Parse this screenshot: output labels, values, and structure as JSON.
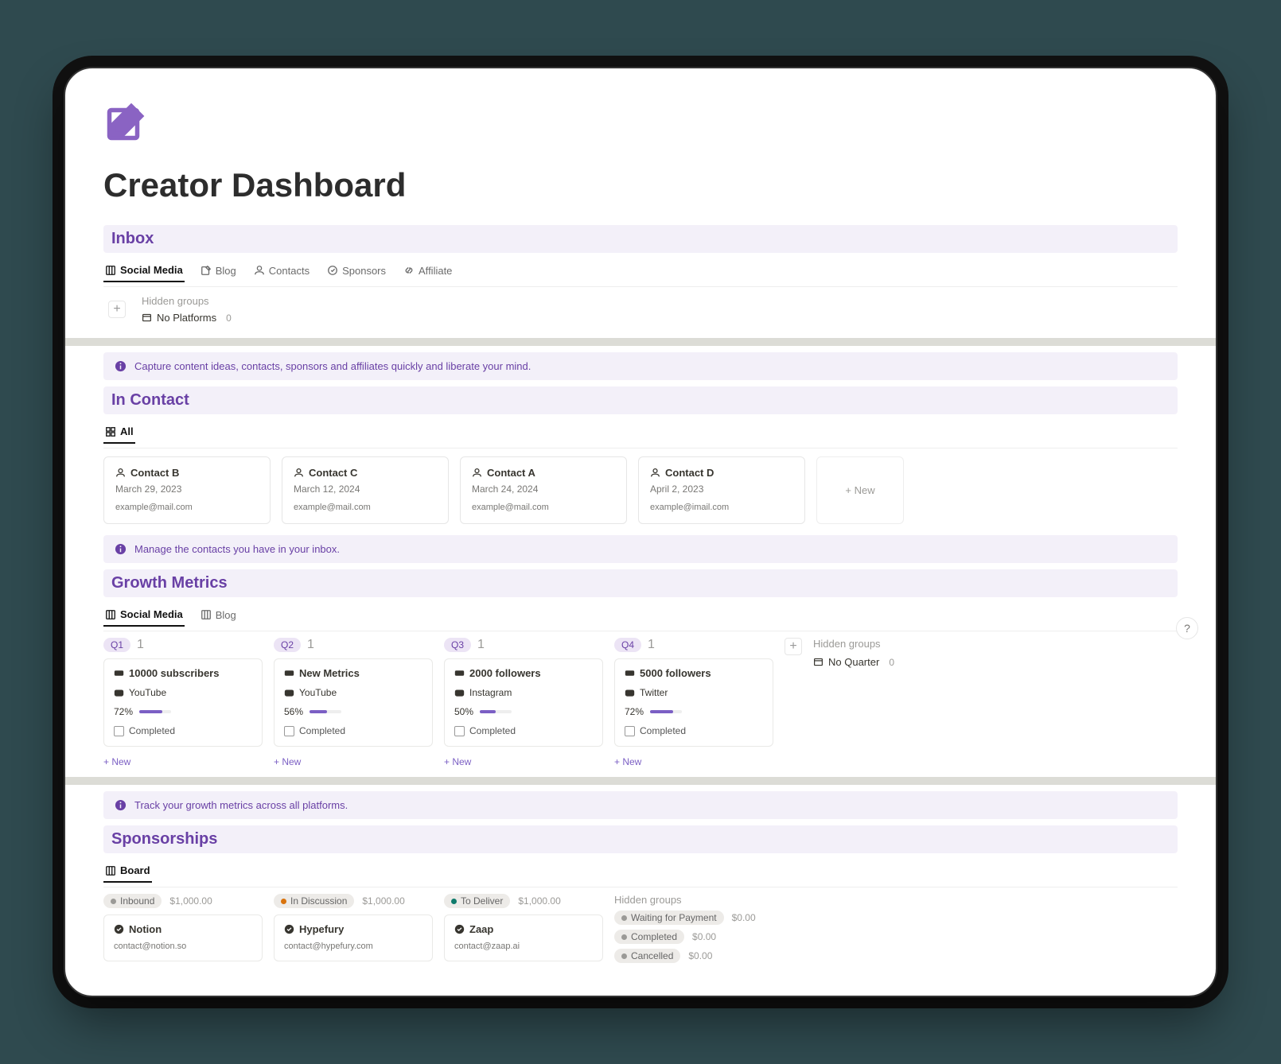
{
  "page": {
    "title": "Creator Dashboard"
  },
  "inbox": {
    "header": "Inbox",
    "tabs": [
      {
        "label": "Social Media"
      },
      {
        "label": "Blog"
      },
      {
        "label": "Contacts"
      },
      {
        "label": "Sponsors"
      },
      {
        "label": "Affiliate"
      }
    ],
    "hidden_groups_label": "Hidden groups",
    "no_platforms_label": "No Platforms",
    "no_platforms_count": "0",
    "info": "Capture content ideas, contacts, sponsors and affiliates quickly and liberate your mind."
  },
  "contacts": {
    "header": "In Contact",
    "tab_label": "All",
    "items": [
      {
        "name": "Contact B",
        "date": "March 29, 2023",
        "email": "example@mail.com"
      },
      {
        "name": "Contact C",
        "date": "March 12, 2024",
        "email": "example@mail.com"
      },
      {
        "name": "Contact A",
        "date": "March 24, 2024",
        "email": "example@mail.com"
      },
      {
        "name": "Contact D",
        "date": "April 2, 2023",
        "email": "example@imail.com"
      }
    ],
    "new_label": "+  New",
    "info": "Manage the contacts you have in your inbox."
  },
  "growth": {
    "header": "Growth Metrics",
    "tabs": [
      {
        "label": "Social Media"
      },
      {
        "label": "Blog"
      }
    ],
    "columns": [
      {
        "quarter": "Q1",
        "count": "1",
        "title": "10000 subscribers",
        "platform": "YouTube",
        "progress_label": "72%",
        "progress_pct": 72,
        "completed_label": "Completed",
        "new_label": "+  New"
      },
      {
        "quarter": "Q2",
        "count": "1",
        "title": "New Metrics",
        "platform": "YouTube",
        "progress_label": "56%",
        "progress_pct": 56,
        "completed_label": "Completed",
        "new_label": "+  New"
      },
      {
        "quarter": "Q3",
        "count": "1",
        "title": "2000 followers",
        "platform": "Instagram",
        "progress_label": "50%",
        "progress_pct": 50,
        "completed_label": "Completed",
        "new_label": "+  New"
      },
      {
        "quarter": "Q4",
        "count": "1",
        "title": "5000 followers",
        "platform": "Twitter",
        "progress_label": "72%",
        "progress_pct": 72,
        "completed_label": "Completed",
        "new_label": "+  New"
      }
    ],
    "hidden_groups_label": "Hidden groups",
    "no_quarter_label": "No Quarter",
    "no_quarter_count": "0",
    "info": "Track your growth metrics across all platforms."
  },
  "sponsorships": {
    "header": "Sponsorships",
    "tab_label": "Board",
    "columns": [
      {
        "status": "Inbound",
        "dot": "#9b9a97",
        "amount": "$1,000.00",
        "name": "Notion",
        "email": "contact@notion.so"
      },
      {
        "status": "In Discussion",
        "dot": "#d9730d",
        "amount": "$1,000.00",
        "name": "Hypefury",
        "email": "contact@hypefury.com"
      },
      {
        "status": "To Deliver",
        "dot": "#0f7b6c",
        "amount": "$1,000.00",
        "name": "Zaap",
        "email": "contact@zaap.ai"
      }
    ],
    "hidden_groups_label": "Hidden groups",
    "hidden_groups": [
      {
        "status": "Waiting for Payment",
        "amount": "$0.00"
      },
      {
        "status": "Completed",
        "amount": "$0.00"
      },
      {
        "status": "Cancelled",
        "amount": "$0.00"
      }
    ]
  },
  "help_label": "?"
}
